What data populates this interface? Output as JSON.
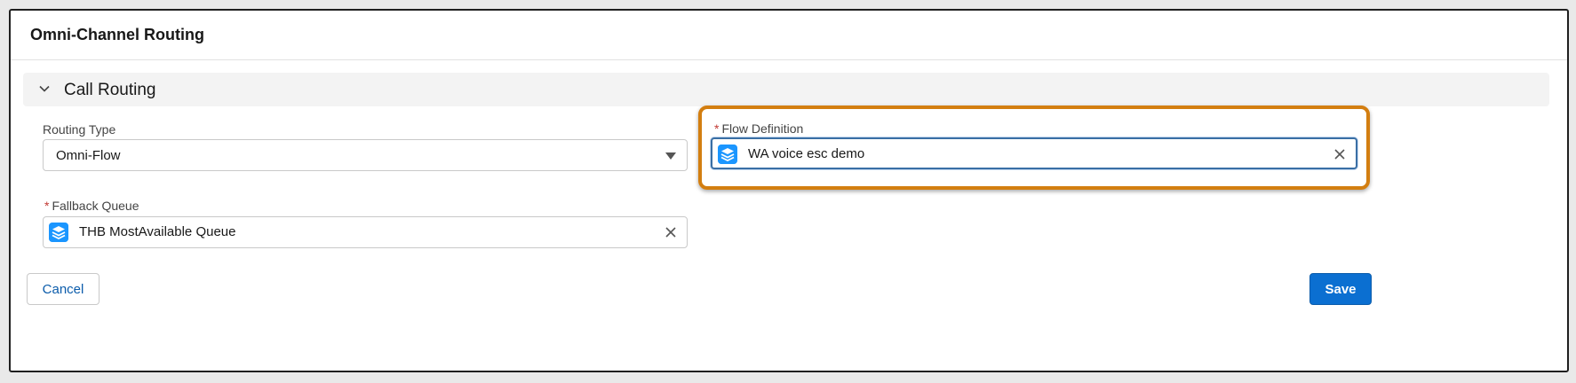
{
  "card": {
    "title": "Omni-Channel Routing"
  },
  "section": {
    "title": "Call Routing",
    "expanded": true
  },
  "routing_type": {
    "label": "Routing Type",
    "value": "Omni-Flow"
  },
  "flow_definition": {
    "label": "Flow Definition",
    "required_marker": "*",
    "value": "WA voice esc demo"
  },
  "fallback_queue": {
    "label": "Fallback Queue",
    "required_marker": "*",
    "value": "THB MostAvailable Queue"
  },
  "buttons": {
    "cancel": "Cancel",
    "save": "Save"
  },
  "icons": {
    "section_toggle": "chevron-down-icon",
    "lookup": "stack-icon",
    "clear": "close-icon",
    "dropdown": "caret-down-icon"
  },
  "colors": {
    "brand_blue": "#0b6fd1",
    "icon_blue": "#1b96ff",
    "required_red": "#c23934",
    "highlight_orange": "#d37e10"
  }
}
